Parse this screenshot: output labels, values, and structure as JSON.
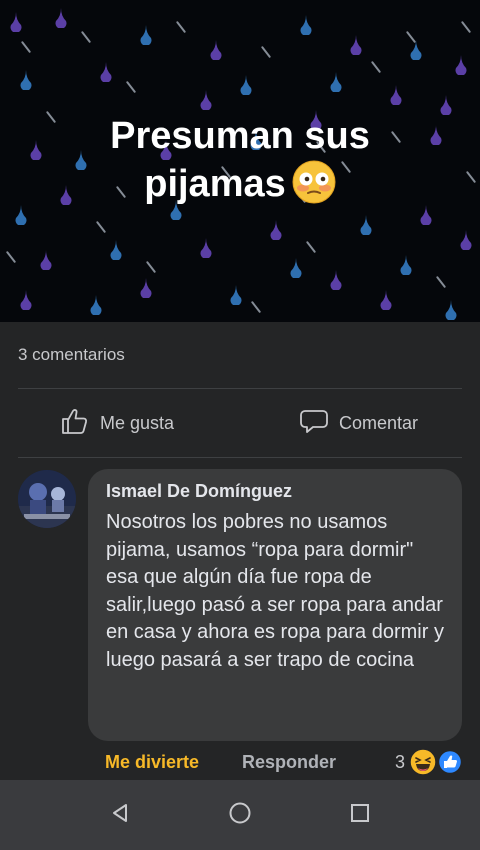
{
  "post": {
    "title_line1": "Presuman sus",
    "title_line2": "pijamas",
    "title_emoji": "flushed-face-emoji"
  },
  "stats": {
    "comment_count_label": "3 comentarios"
  },
  "actions": {
    "like_label": "Me gusta",
    "comment_label": "Comentar"
  },
  "comment": {
    "author": "Ismael De Domínguez",
    "text": "Nosotros los pobres no usamos pijama, usamos “ropa para dormir\" esa que algún día fue ropa de salir,luego pasó a ser ropa para andar en casa y ahora es ropa para dormir y luego pasará a ser trapo de cocina",
    "reaction_label": "Me divierte",
    "reply_label": "Responder",
    "reaction_count": "3",
    "reaction_icons": [
      "haha-icon",
      "like-icon"
    ]
  },
  "colors": {
    "banner_bg": "#05070b",
    "drop_purple": "#5b3fa6",
    "drop_blue": "#2f6fb0",
    "panel_bg": "#242526",
    "bubble_bg": "#3a3b3c",
    "reaction_gold": "#f7b928",
    "nav_bg": "#3a3b3e"
  }
}
